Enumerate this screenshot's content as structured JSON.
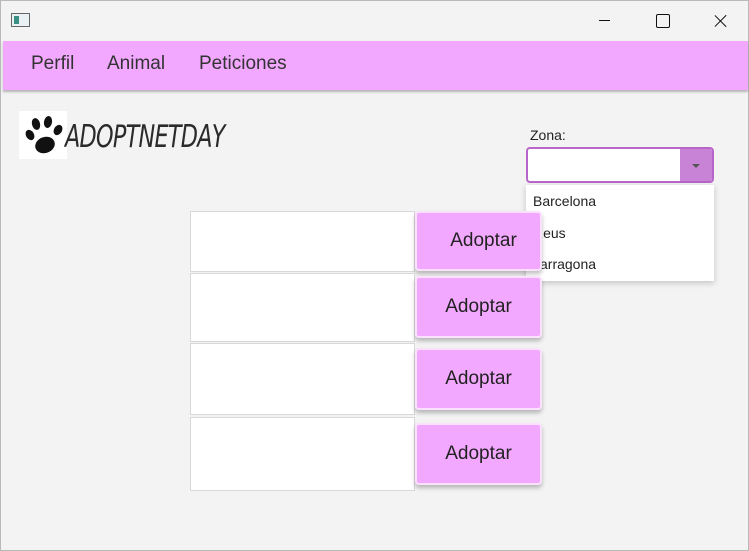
{
  "menu": {
    "items": [
      "Perfil",
      "Animal",
      "Peticiones"
    ]
  },
  "brand": {
    "name": "ADOPTNETDAY",
    "icon": "paw-icon"
  },
  "zona": {
    "label": "Zona:",
    "value": "",
    "options": [
      "Barcelona",
      "Reus",
      "Tarragona"
    ]
  },
  "listings": {
    "button_label": "Adoptar",
    "rows": [
      {
        "button_label": "Adoptar"
      },
      {
        "button_label": "Adoptar"
      },
      {
        "button_label": "Adoptar"
      },
      {
        "button_label": "Adoptar"
      }
    ]
  },
  "colors": {
    "accent": "#f3a8ff",
    "accent_dark": "#c983d6",
    "combo_border": "#b866c9"
  }
}
